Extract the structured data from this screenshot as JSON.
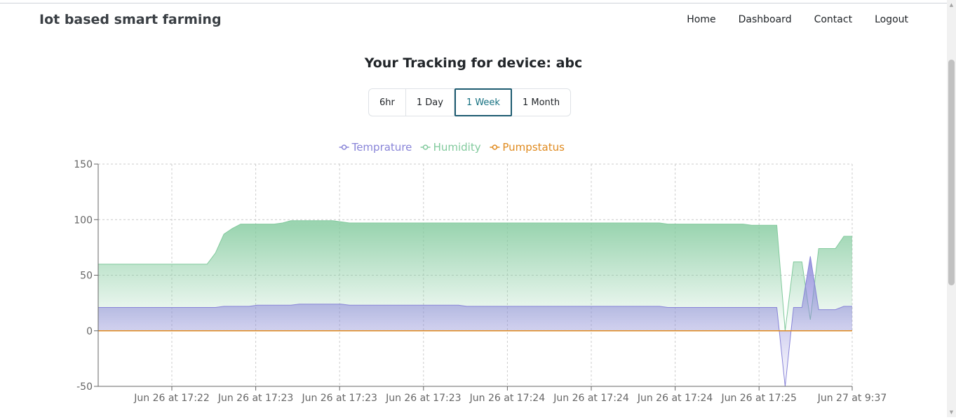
{
  "navbar": {
    "brand": "Iot based smart farming",
    "links": [
      "Home",
      "Dashboard",
      "Contact",
      "Logout"
    ]
  },
  "page": {
    "title": "Your Tracking for device: abc"
  },
  "range_buttons": [
    {
      "label": "6hr",
      "active": false
    },
    {
      "label": "1 Day",
      "active": false
    },
    {
      "label": "1 Week",
      "active": true
    },
    {
      "label": "1 Month",
      "active": false
    }
  ],
  "colors": {
    "temperature": "#8884d8",
    "humidity": "#82ca9d",
    "pumpstatus": "#e08a1e",
    "grid": "#cccccc",
    "axis": "#666666",
    "active_button": "#1d5b70"
  },
  "icons": {
    "scroll_up": "scroll-up-arrow-icon",
    "scroll_down": "scroll-down-arrow-icon"
  },
  "chart_data": {
    "type": "area",
    "ylim": [
      -50,
      150
    ],
    "yticks": [
      -50,
      0,
      50,
      100,
      150
    ],
    "grid": true,
    "legend": "top-center",
    "tick_labels": [
      "Jun 26 at 17:22",
      "Jun 26 at 17:23",
      "Jun 26 at 17:23",
      "Jun 26 at 17:23",
      "Jun 26 at 17:24",
      "Jun 26 at 17:24",
      "Jun 26 at 17:24",
      "Jun 26 at 17:25",
      "Jun 27 at 9:37"
    ],
    "x": [
      0,
      1,
      2,
      3,
      4,
      5,
      6,
      7,
      8,
      9,
      10,
      11,
      12,
      13,
      14,
      15,
      16,
      17,
      18,
      19,
      20,
      21,
      22,
      23,
      24,
      25,
      26,
      27,
      28,
      29,
      30,
      31,
      32,
      33,
      34,
      35,
      36,
      37,
      38,
      39,
      40,
      41,
      42,
      43,
      44,
      45,
      46,
      47,
      48,
      49,
      50,
      51,
      52,
      53,
      54,
      55,
      56,
      57,
      58,
      59,
      60,
      61,
      62,
      63,
      64,
      65,
      66,
      67,
      68,
      69,
      70,
      71,
      72,
      73,
      74,
      75,
      76,
      77,
      78,
      79,
      80,
      81,
      82,
      83,
      84,
      85,
      86,
      87,
      88,
      89,
      90
    ],
    "series": [
      {
        "name": "Temprature",
        "values": [
          21,
          21,
          21,
          21,
          21,
          21,
          21,
          21,
          21,
          21,
          21,
          21,
          21,
          21,
          21,
          22,
          22,
          22,
          22,
          23,
          23,
          23,
          23,
          23,
          24,
          24,
          24,
          24,
          24,
          24,
          23,
          23,
          23,
          23,
          23,
          23,
          23,
          23,
          23,
          23,
          23,
          23,
          23,
          23,
          22,
          22,
          22,
          22,
          22,
          22,
          22,
          22,
          22,
          22,
          22,
          22,
          22,
          22,
          22,
          22,
          22,
          22,
          22,
          22,
          22,
          22,
          22,
          22,
          21,
          21,
          21,
          21,
          21,
          21,
          21,
          21,
          21,
          21,
          21,
          21,
          21,
          21,
          -50,
          21,
          21,
          67,
          19,
          19,
          19,
          22,
          22
        ]
      },
      {
        "name": "Humidity",
        "values": [
          60,
          60,
          60,
          60,
          60,
          60,
          60,
          60,
          60,
          60,
          60,
          60,
          60,
          60,
          70,
          87,
          92,
          96,
          96,
          96,
          96,
          96,
          97,
          99,
          99,
          99,
          99,
          99,
          99,
          98,
          97,
          97,
          97,
          97,
          97,
          97,
          97,
          97,
          97,
          97,
          97,
          97,
          97,
          97,
          97,
          97,
          97,
          97,
          97,
          97,
          97,
          97,
          97,
          97,
          97,
          97,
          97,
          97,
          97,
          97,
          97,
          97,
          97,
          97,
          97,
          97,
          97,
          97,
          96,
          96,
          96,
          96,
          96,
          96,
          96,
          96,
          96,
          96,
          95,
          95,
          95,
          95,
          0,
          62,
          62,
          10,
          74,
          74,
          74,
          85,
          85
        ]
      },
      {
        "name": "Pumpstatus",
        "values": [
          0,
          0,
          0,
          0,
          0,
          0,
          0,
          0,
          0,
          0,
          0,
          0,
          0,
          0,
          0,
          0,
          0,
          0,
          0,
          0,
          0,
          0,
          0,
          0,
          0,
          0,
          0,
          0,
          0,
          0,
          0,
          0,
          0,
          0,
          0,
          0,
          0,
          0,
          0,
          0,
          0,
          0,
          0,
          0,
          0,
          0,
          0,
          0,
          0,
          0,
          0,
          0,
          0,
          0,
          0,
          0,
          0,
          0,
          0,
          0,
          0,
          0,
          0,
          0,
          0,
          0,
          0,
          0,
          0,
          0,
          0,
          0,
          0,
          0,
          0,
          0,
          0,
          0,
          0,
          0,
          0,
          0,
          0,
          0,
          0,
          0,
          0,
          0,
          0,
          0,
          0
        ]
      }
    ]
  }
}
